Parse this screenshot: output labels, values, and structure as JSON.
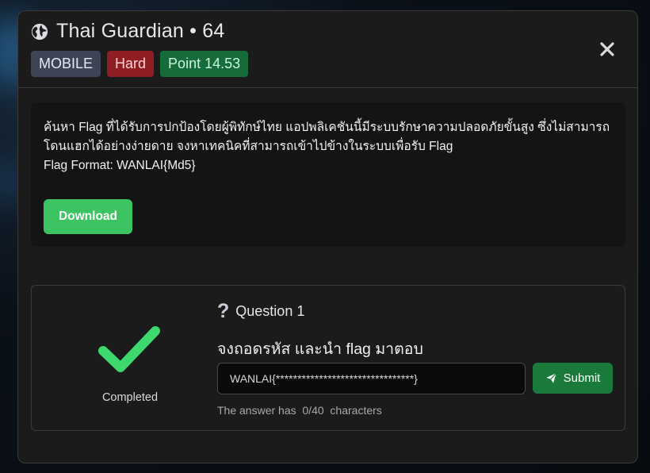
{
  "challenge": {
    "title": "Thai Guardian • 64",
    "category": "MOBILE",
    "difficulty": "Hard",
    "points": "Point 14.53"
  },
  "description": {
    "line1": "ค้นหา Flag ที่ได้รับการปกป้องโดยผู้พิทักษ์ไทย แอปพลิเคชันนี้มีระบบรักษาความปลอดภัยขั้นสูง ซึ่งไม่สามารถ",
    "line2": "โดนแฮกได้อย่างง่ายดาย จงหาเทคนิคที่สามารถเข้าไปข้างในระบบเพื่อรับ Flag",
    "line3": "Flag Format: WANLAI{Md5}"
  },
  "download_label": "Download",
  "question": {
    "status": "Completed",
    "title": "Question 1",
    "text": "จงถอดรหัส และนำ flag มาตอบ",
    "answer_value": "WANLAI{********************************}",
    "submit_label": "Submit",
    "count_prefix": "The answer has",
    "count_value": "0/40",
    "count_suffix": "characters"
  },
  "icons": {
    "title": "globe-icon",
    "close": "close-icon",
    "status": "checkmark-icon",
    "question": "question-mark-icon",
    "submit": "paper-plane-icon"
  },
  "colors": {
    "difficulty_bg": "#8f1d22",
    "points_bg": "#166b3a",
    "download_bg": "#3dc462",
    "check": "#3dd86e",
    "submit_bg": "#197a3b"
  }
}
